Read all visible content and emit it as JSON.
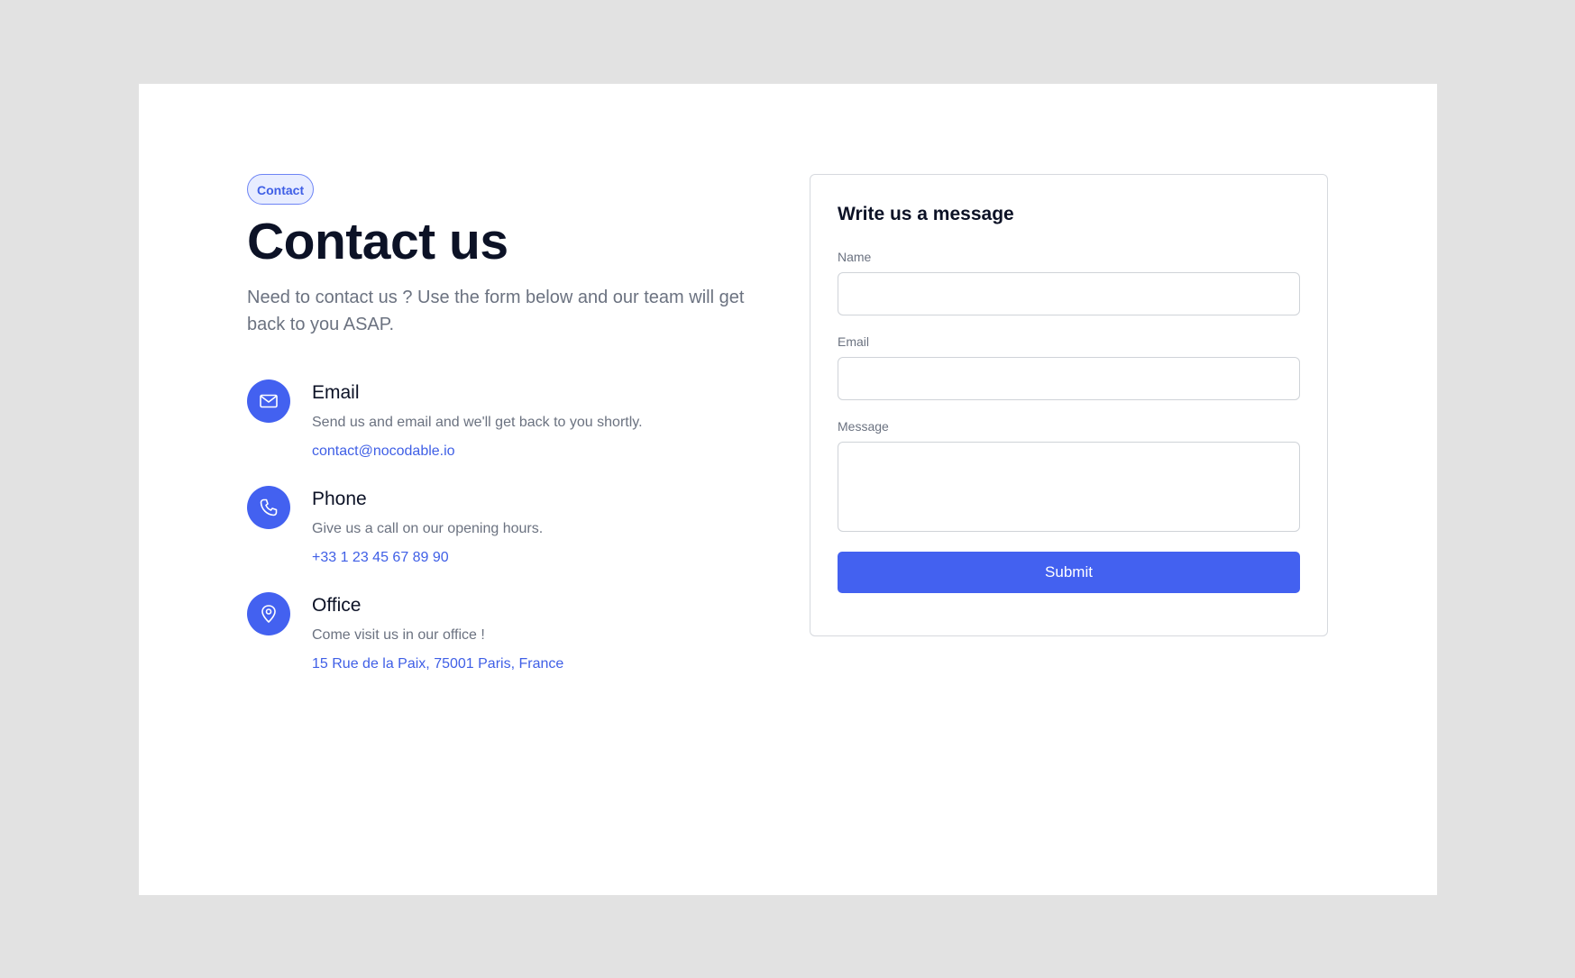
{
  "badge": "Contact",
  "page_title": "Contact us",
  "subtitle": "Need to contact us ? Use the form below and our team will get back to you ASAP.",
  "contact_items": [
    {
      "icon": "envelope-icon",
      "title": "Email",
      "description": "Send us and email and we'll get back to you shortly.",
      "link": "contact@nocodable.io"
    },
    {
      "icon": "phone-icon",
      "title": "Phone",
      "description": "Give us a call on our opening hours.",
      "link": "+33 1 23 45 67 89 90"
    },
    {
      "icon": "map-pin-icon",
      "title": "Office",
      "description": "Come visit us in our office !",
      "link": "15 Rue de la Paix, 75001 Paris, France"
    }
  ],
  "form": {
    "title": "Write us a message",
    "name_label": "Name",
    "name_value": "",
    "email_label": "Email",
    "email_value": "",
    "message_label": "Message",
    "message_value": "",
    "submit_label": "Submit"
  },
  "colors": {
    "accent": "#4361f0",
    "link": "#3f5fe6",
    "page_background": "#e2e2e2",
    "heading": "#0c1226",
    "muted_text": "#6b7280"
  }
}
